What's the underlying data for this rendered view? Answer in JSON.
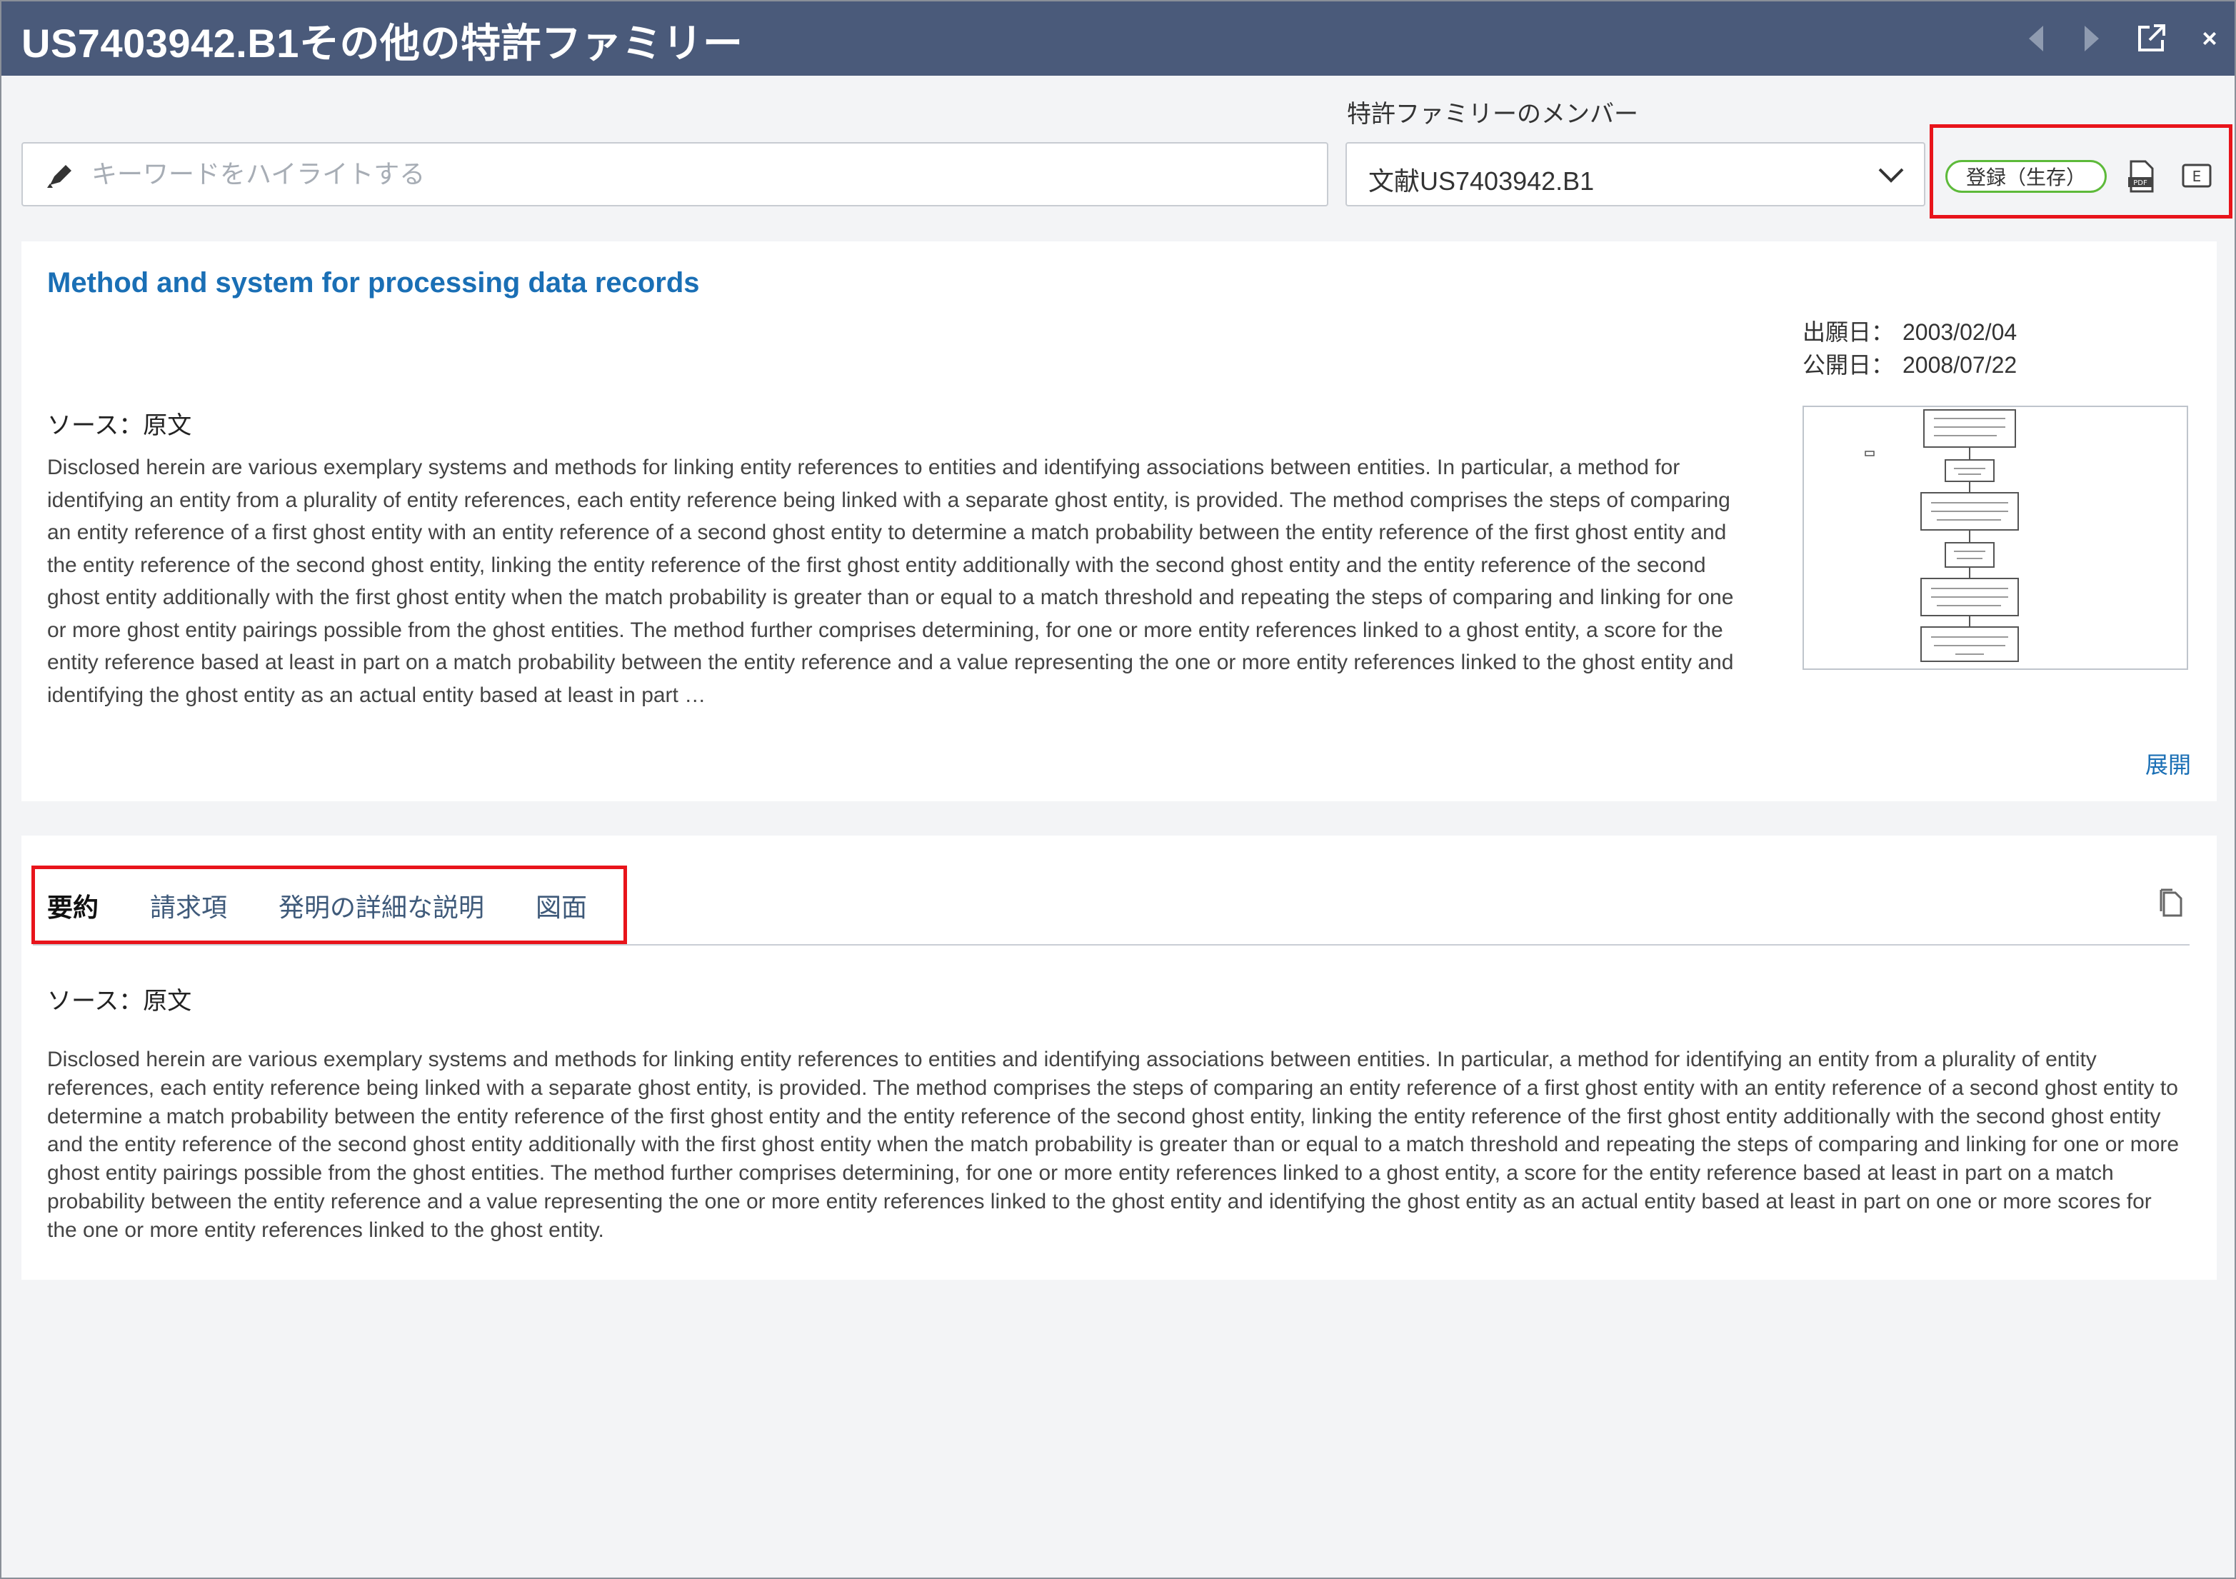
{
  "window": {
    "title": "US7403942.B1その他の特許ファミリー"
  },
  "toolbar": {
    "prev_icon": "chevron-left-icon",
    "next_icon": "chevron-right-icon",
    "popout_icon": "external-link-icon",
    "close_label": "×"
  },
  "search": {
    "placeholder": "キーワードをハイライトする",
    "value": ""
  },
  "family": {
    "label": "特許ファミリーのメンバー",
    "selected": "文献US7403942.B1"
  },
  "status": {
    "label": "登録（生存）",
    "color": "#5dba3a"
  },
  "actions": {
    "pdf_label": "PDF",
    "e_label": "E"
  },
  "document": {
    "title": "Method and system for processing data records",
    "filing_date_label": "出願日：",
    "filing_date": "2003/02/04",
    "publication_date_label": "公開日：",
    "publication_date": "2008/07/22",
    "source_label": "ソース：原文",
    "abstract_truncated": "Disclosed herein are various exemplary systems and methods for linking entity references to entities and identifying associations between entities. In particular, a method for identifying an entity from a plurality of entity references, each entity reference being linked with a separate ghost entity, is provided. The method comprises the steps of comparing an entity reference of a first ghost entity with an entity reference of a second ghost entity to determine a match probability between the entity reference of the first ghost entity and the entity reference of the second ghost entity, linking the entity reference of the first ghost entity additionally with the second ghost entity and the entity reference of the second ghost entity additionally with the first ghost entity when the match probability is greater than or equal to a match threshold and repeating the steps of comparing and linking for one or more ghost entity pairings possible from the ghost entities. The method further comprises determining, for one or more entity references linked to a ghost entity, a score for the entity reference based at least in part on a match probability between the entity reference and a value representing the one or more entity references linked to the ghost entity and identifying the ghost entity as an actual entity based at least in part …",
    "expand_label": "展開"
  },
  "tabs": [
    {
      "label": "要約",
      "active": true
    },
    {
      "label": "請求項",
      "active": false
    },
    {
      "label": "発明の詳細な説明",
      "active": false
    },
    {
      "label": "図面",
      "active": false
    }
  ],
  "section": {
    "source_label": "ソース：原文",
    "abstract_full": "Disclosed herein are various exemplary systems and methods for linking entity references to entities and identifying associations between entities. In particular, a method for identifying an entity from a plurality of entity references, each entity reference being linked with a separate ghost entity, is provided. The method comprises the steps of comparing an entity reference of a first ghost entity with an entity reference of a second ghost entity to determine a match probability between the entity reference of the first ghost entity and the entity reference of the second ghost entity, linking the entity reference of the first ghost entity additionally with the second ghost entity and the entity reference of the second ghost entity additionally with the first ghost entity when the match probability is greater than or equal to a match threshold and repeating the steps of comparing and linking for one or more ghost entity pairings possible from the ghost entities. The method further comprises determining, for one or more entity references linked to a ghost entity, a score for the entity reference based at least in part on a match probability between the entity reference and a value representing the one or more entity references linked to the ghost entity and identifying the ghost entity as an actual entity based at least in part on one or more scores for the one or more entity references linked to the ghost entity."
  },
  "colors": {
    "titlebar": "#4a5a7a",
    "link": "#1a6fb5",
    "highlight_box": "#e8141b"
  }
}
